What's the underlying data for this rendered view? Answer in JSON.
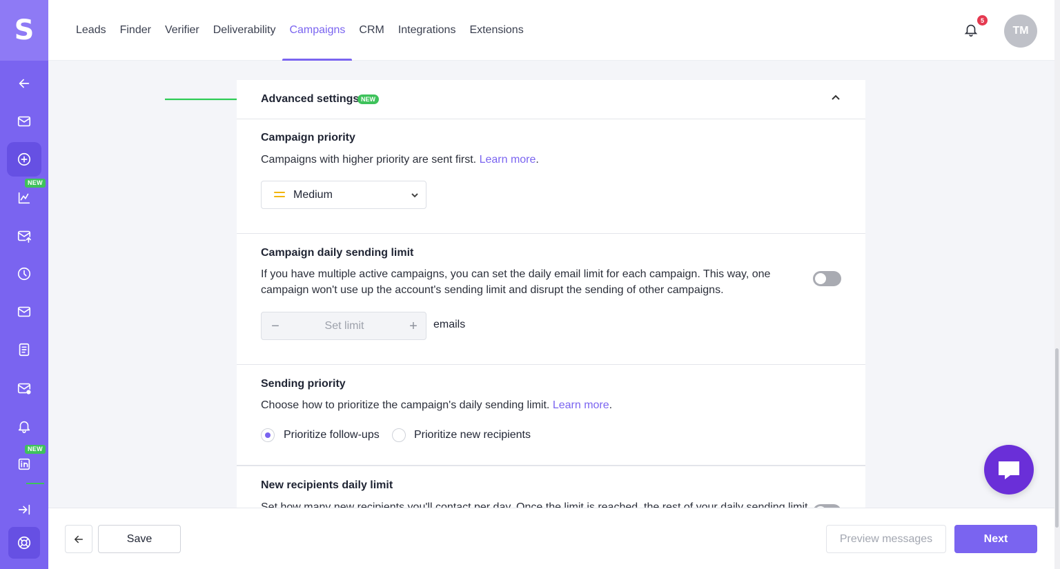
{
  "brand": {
    "logo_letter": "S",
    "accent": "#7a64f0",
    "new_badge_color": "#3ec25b"
  },
  "sidebar": {
    "items": [
      {
        "icon": "arrow-left-icon"
      },
      {
        "icon": "mail-icon"
      },
      {
        "icon": "plus-circle-icon",
        "active": true
      },
      {
        "icon": "chart-icon",
        "badge": "NEW"
      },
      {
        "icon": "mail-send-icon"
      },
      {
        "icon": "clock-icon"
      },
      {
        "icon": "mail-icon"
      },
      {
        "icon": "document-icon"
      },
      {
        "icon": "mail-dot-icon"
      },
      {
        "icon": "bell-icon"
      },
      {
        "icon": "linkedin-icon",
        "badge": "NEW"
      },
      {
        "icon": "collapse-right-icon"
      },
      {
        "icon": "lifebuoy-icon"
      }
    ]
  },
  "nav": {
    "items": [
      {
        "label": "Leads"
      },
      {
        "label": "Finder"
      },
      {
        "label": "Verifier"
      },
      {
        "label": "Deliverability"
      },
      {
        "label": "Campaigns",
        "active": true
      },
      {
        "label": "CRM"
      },
      {
        "label": "Integrations"
      },
      {
        "label": "Extensions"
      }
    ],
    "notifications_count": "5",
    "avatar_initials": "TM"
  },
  "advanced": {
    "title": "Advanced settings",
    "badge": "NEW",
    "campaign_priority": {
      "title": "Campaign priority",
      "desc": "Campaigns with higher priority are sent first. ",
      "link": "Learn more",
      "after_link": ".",
      "selected": "Medium"
    },
    "daily_limit": {
      "title": "Campaign daily sending limit",
      "desc_line1": "If you have multiple active campaigns, you can set the daily email limit for each campaign. This way, one",
      "desc_line2": "campaign won't use up the account's sending limit and disrupt the sending of other campaigns.",
      "enabled": false,
      "minus": "−",
      "plus": "+",
      "placeholder": "Set limit",
      "unit": "emails"
    },
    "sending_priority": {
      "title": "Sending priority",
      "desc": "Choose how to prioritize the campaign's daily sending limit. ",
      "link": "Learn more",
      "after_link": ".",
      "options": [
        {
          "label": "Prioritize follow-ups",
          "checked": true
        },
        {
          "label": "Prioritize new recipients",
          "checked": false
        }
      ]
    },
    "new_recipients": {
      "title": "New recipients daily limit",
      "desc": "Set how many new recipients you'll contact per day. Once the limit is reached, the rest of your daily sending limit",
      "enabled": false
    }
  },
  "footer": {
    "save_label": "Save",
    "preview_label": "Preview messages",
    "next_label": "Next"
  }
}
